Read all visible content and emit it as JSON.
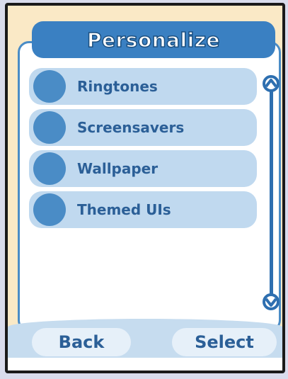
{
  "header": {
    "title": "Personalize"
  },
  "menu": {
    "items": [
      {
        "label": "Ringtones"
      },
      {
        "label": "Screensavers"
      },
      {
        "label": "Wallpaper"
      },
      {
        "label": "Themed UIs"
      }
    ]
  },
  "softkeys": {
    "left_label": "Back",
    "right_label": "Select"
  },
  "colors": {
    "accent": "#3a80c2",
    "item_background": "#c0d9ef",
    "item_text": "#2b5f97",
    "frame_background": "#fae9c6"
  },
  "icons": {
    "scroll_up": "scroll-up-arrow-icon",
    "scroll_down": "scroll-down-arrow-icon",
    "menu_bullet": "circle-bullet-icon"
  }
}
